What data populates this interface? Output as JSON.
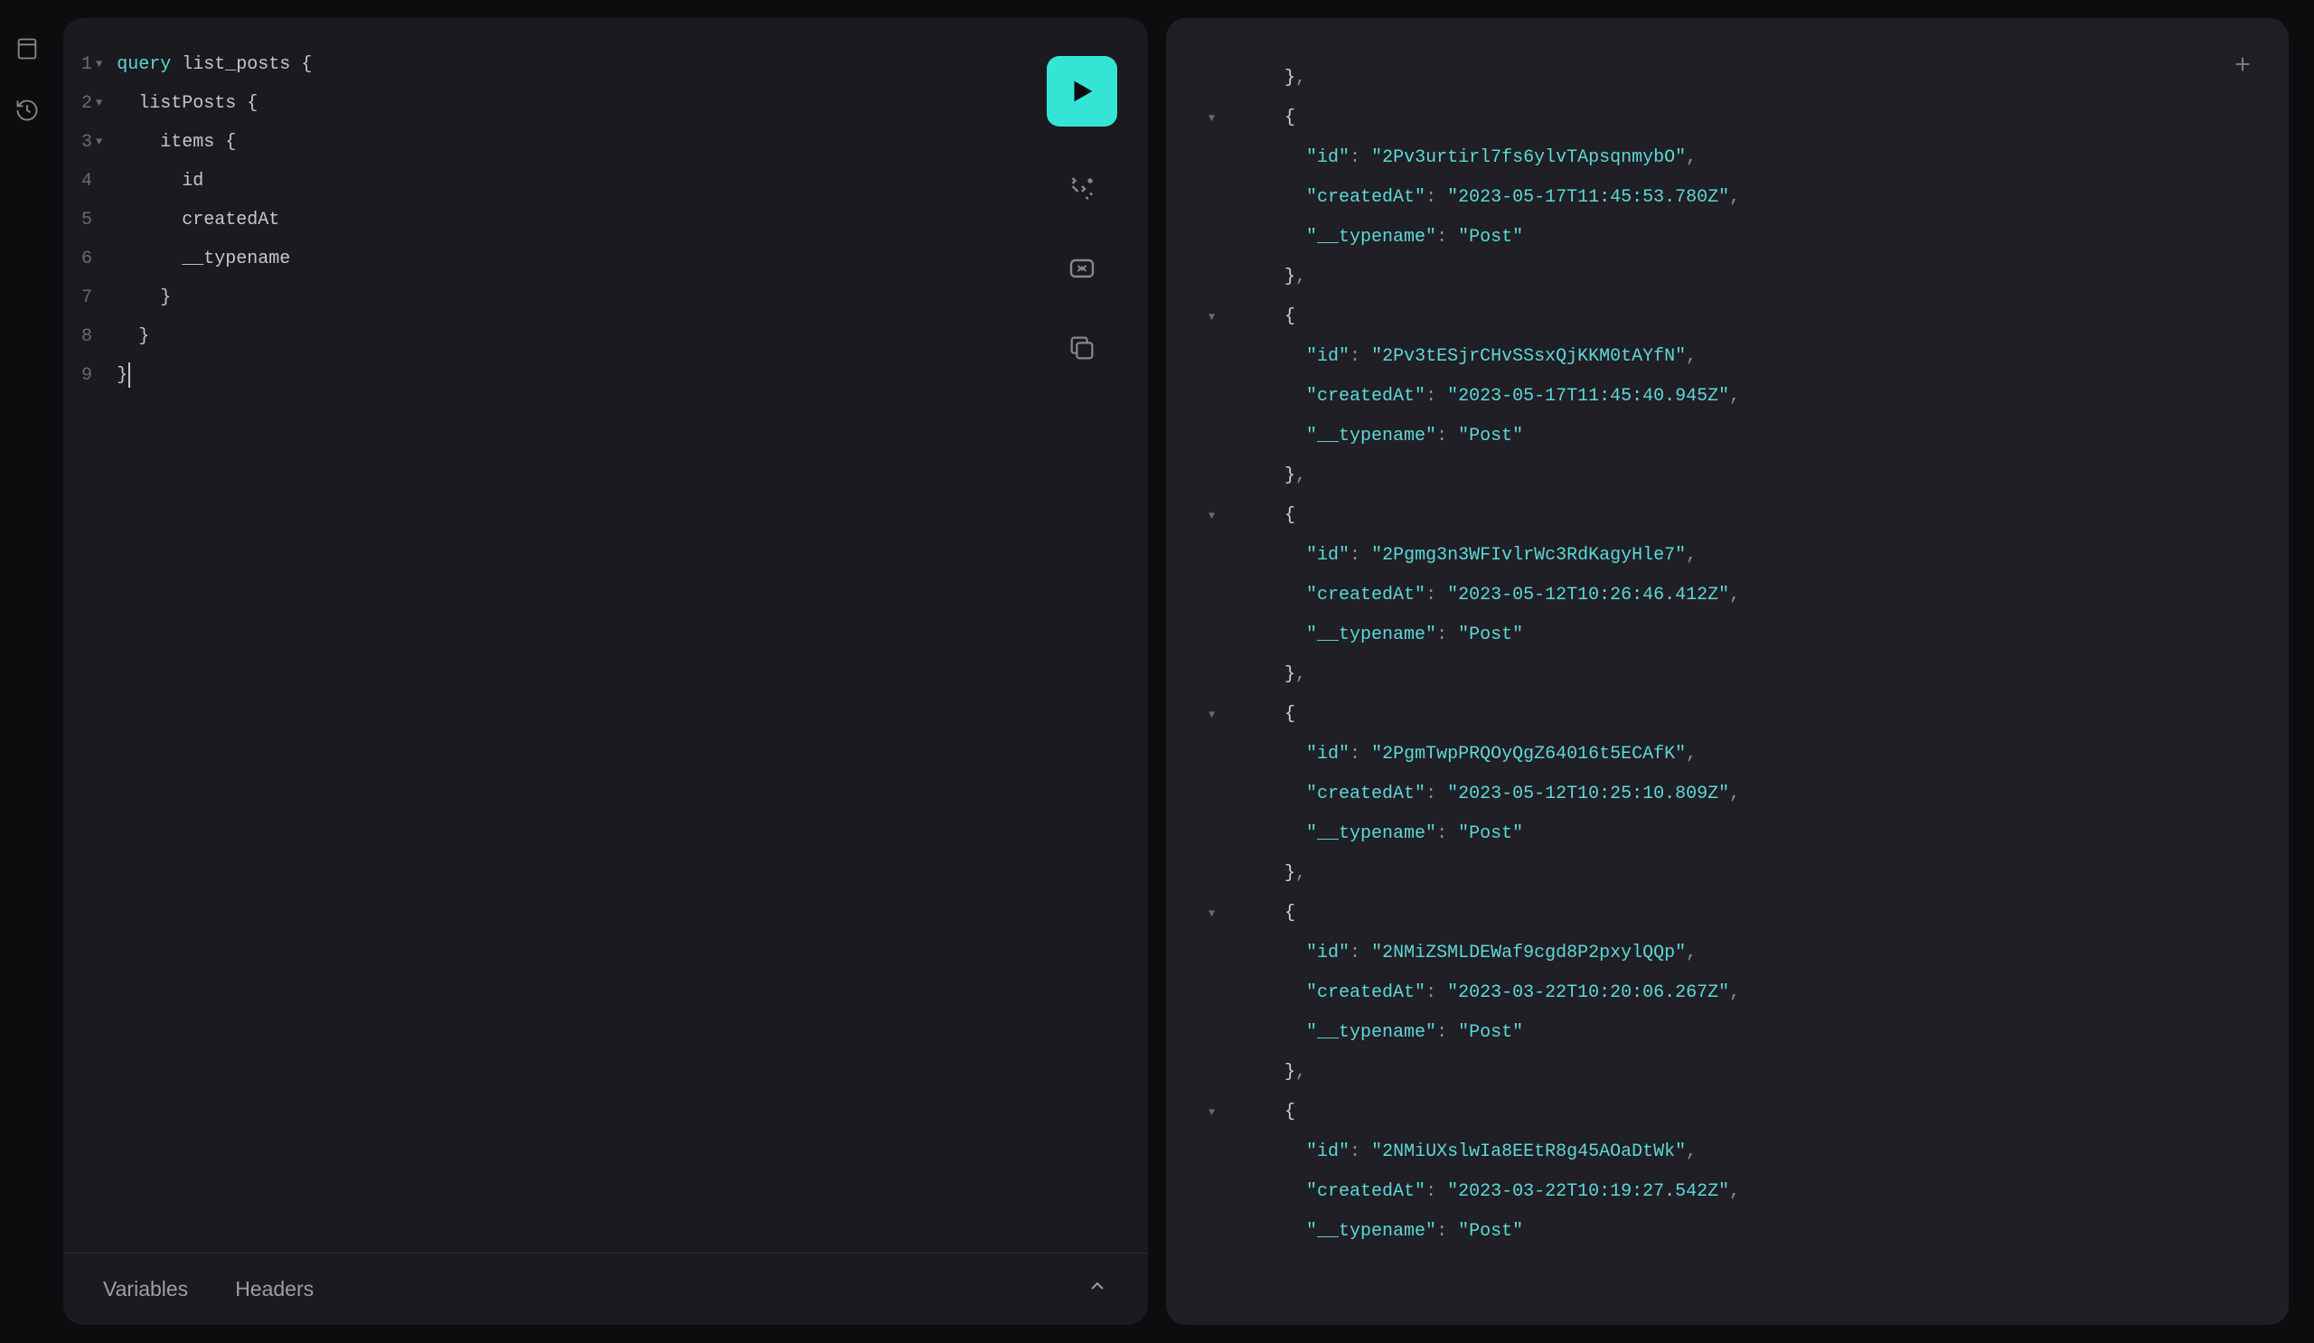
{
  "editor": {
    "lines": [
      {
        "num": "1",
        "fold": true,
        "tokens": [
          {
            "t": "kw",
            "v": "query"
          },
          {
            "t": "sp",
            "v": " "
          },
          {
            "t": "name",
            "v": "list_posts"
          },
          {
            "t": "sp",
            "v": " "
          },
          {
            "t": "punct",
            "v": "{"
          }
        ]
      },
      {
        "num": "2",
        "fold": true,
        "tokens": [
          {
            "t": "sp",
            "v": "  "
          },
          {
            "t": "name",
            "v": "listPosts"
          },
          {
            "t": "sp",
            "v": " "
          },
          {
            "t": "punct",
            "v": "{"
          }
        ]
      },
      {
        "num": "3",
        "fold": true,
        "tokens": [
          {
            "t": "sp",
            "v": "    "
          },
          {
            "t": "name",
            "v": "items"
          },
          {
            "t": "sp",
            "v": " "
          },
          {
            "t": "punct",
            "v": "{"
          }
        ]
      },
      {
        "num": "4",
        "fold": false,
        "tokens": [
          {
            "t": "sp",
            "v": "      "
          },
          {
            "t": "name",
            "v": "id"
          }
        ]
      },
      {
        "num": "5",
        "fold": false,
        "tokens": [
          {
            "t": "sp",
            "v": "      "
          },
          {
            "t": "name",
            "v": "createdAt"
          }
        ]
      },
      {
        "num": "6",
        "fold": false,
        "tokens": [
          {
            "t": "sp",
            "v": "      "
          },
          {
            "t": "name",
            "v": "__typename"
          }
        ]
      },
      {
        "num": "7",
        "fold": false,
        "tokens": [
          {
            "t": "sp",
            "v": "    "
          },
          {
            "t": "punct",
            "v": "}"
          }
        ]
      },
      {
        "num": "8",
        "fold": false,
        "tokens": [
          {
            "t": "sp",
            "v": "  "
          },
          {
            "t": "punct",
            "v": "}"
          }
        ]
      },
      {
        "num": "9",
        "fold": false,
        "tokens": [
          {
            "t": "punct",
            "v": "}"
          }
        ],
        "cursor": true
      }
    ]
  },
  "bottom": {
    "variables": "Variables",
    "headers": "Headers"
  },
  "response": {
    "items": [
      {
        "id": "2Pv3urtirl7fs6ylvTApsqnmybO",
        "createdAt": "2023-05-17T11:45:53.780Z",
        "__typename": "Post"
      },
      {
        "id": "2Pv3tESjrCHvSSsxQjKKM0tAYfN",
        "createdAt": "2023-05-17T11:45:40.945Z",
        "__typename": "Post"
      },
      {
        "id": "2Pgmg3n3WFIvlrWc3RdKagyHle7",
        "createdAt": "2023-05-12T10:26:46.412Z",
        "__typename": "Post"
      },
      {
        "id": "2PgmTwpPRQOyQgZ64016t5ECAfK",
        "createdAt": "2023-05-12T10:25:10.809Z",
        "__typename": "Post"
      },
      {
        "id": "2NMiZSMLDEWaf9cgd8P2pxylQQp",
        "createdAt": "2023-03-22T10:20:06.267Z",
        "__typename": "Post"
      },
      {
        "id": "2NMiUXslwIa8EEtR8g45AOaDtWk",
        "createdAt": "2023-03-22T10:19:27.542Z",
        "__typename": "Post"
      }
    ]
  }
}
